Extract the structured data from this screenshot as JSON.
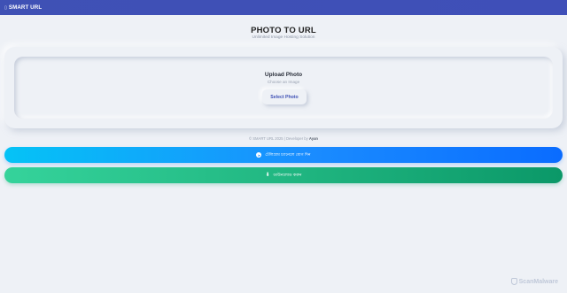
{
  "header": {
    "brand": "SMART URL",
    "brand_icon": "link-icon"
  },
  "main": {
    "title": "PHOTO TO URL",
    "subtitle": "Unlimited Image Hosting Solution"
  },
  "upload": {
    "title": "Upload Photo",
    "subtitle": "Choose an Image",
    "button_label": "Select Photo"
  },
  "footer": {
    "credit_prefix": "© SMART URL 2025 | Developer by",
    "developer": "Ayan"
  },
  "actions": {
    "primary_label": "টেলিগ্রাম চ্যানেলে যোগ দিন",
    "primary_icon": "telegram-icon",
    "secondary_label": "ডাউনলোড করুন",
    "secondary_icon": "download-icon"
  },
  "watermark": {
    "text": "ScanMalware"
  },
  "colors": {
    "header_bg": "#3f51b5",
    "page_bg": "#eef1f6",
    "accent": "#3f51b5",
    "primary_gradient_start": "#05c3f6",
    "primary_gradient_end": "#0a6cff",
    "secondary_gradient_start": "#35d39b",
    "secondary_gradient_end": "#0b9868"
  }
}
